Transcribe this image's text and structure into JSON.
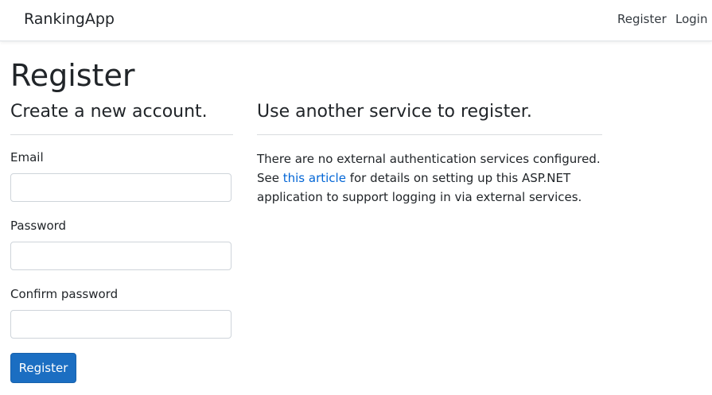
{
  "navbar": {
    "brand": "RankingApp",
    "links": [
      {
        "label": "Register"
      },
      {
        "label": "Login"
      }
    ]
  },
  "page": {
    "title": "Register"
  },
  "register_form": {
    "heading": "Create a new account.",
    "email_label": "Email",
    "email_value": "",
    "password_label": "Password",
    "password_value": "",
    "confirm_password_label": "Confirm password",
    "confirm_password_value": "",
    "submit_label": "Register"
  },
  "external": {
    "heading": "Use another service to register.",
    "text_before": "There are no external authentication services configured. See ",
    "link_text": "this article",
    "text_after": " for details on setting up this ASP.NET application to support logging in via external services."
  },
  "colors": {
    "primary_button": "#1b6ec2",
    "link": "#0366d6",
    "text": "#212529"
  }
}
